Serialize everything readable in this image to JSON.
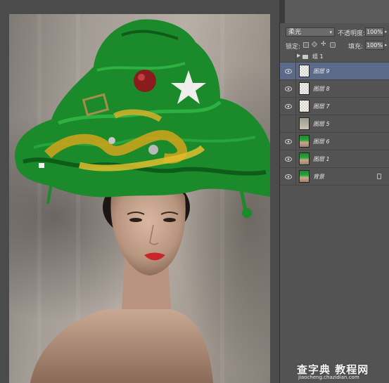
{
  "options": {
    "blend_mode": "柔光",
    "opacity_label": "不透明度:",
    "opacity_value": "100%",
    "lock_label": "锁定:",
    "fill_label": "填充:",
    "fill_value": "100%"
  },
  "layers": [
    {
      "name": "组 1",
      "type": "group"
    },
    {
      "name": "图层 9",
      "type": "layer",
      "selected": true
    },
    {
      "name": "图层 8",
      "type": "layer"
    },
    {
      "name": "图层 7",
      "type": "layer"
    },
    {
      "name": "图层 5",
      "type": "layer"
    },
    {
      "name": "图层 6",
      "type": "layer"
    },
    {
      "name": "图层 1",
      "type": "layer"
    },
    {
      "name": "背景",
      "type": "background"
    }
  ],
  "watermark": {
    "title": "查字典 教程网",
    "url": "jiaocheng.chazidian.com"
  },
  "colors": {
    "panel_bg": "#535353",
    "selected_row": "#5c6a8a",
    "tinsel_green": "#1f8f2c",
    "tinsel_gold": "#c9a21c"
  }
}
